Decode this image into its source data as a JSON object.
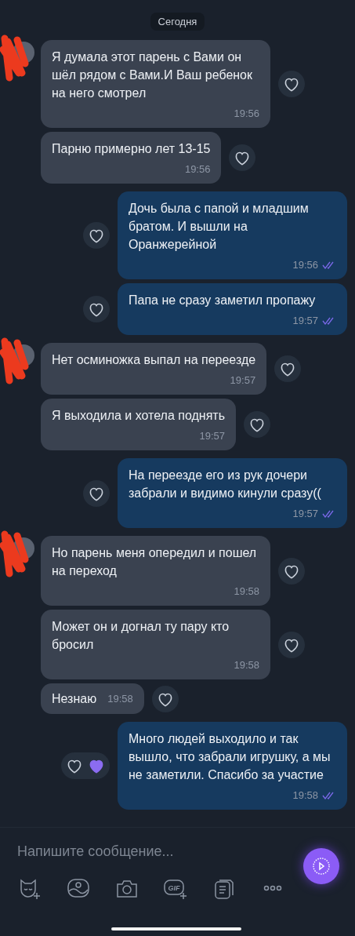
{
  "date_divider": "Сегодня",
  "groups": [
    {
      "kind": "incoming",
      "messages": [
        {
          "kind": "normal",
          "text": "Я думала этот парень с Вами он шёл рядом с Вами.И Ваш ребенок на него смотрел",
          "time": "19:56",
          "reacted": false
        },
        {
          "kind": "normal",
          "text": "Парню примерно лет 13-15",
          "time": "19:56",
          "reacted": false
        }
      ]
    },
    {
      "kind": "outgoing",
      "messages": [
        {
          "kind": "normal",
          "text": "Дочь была с папой и младшим братом. И вышли на Оранжерейной",
          "time": "19:56",
          "read": true,
          "reacted": false
        },
        {
          "kind": "normal",
          "text": "Папа не сразу заметил пропажу",
          "time": "19:57",
          "read": true,
          "reacted": false
        }
      ]
    },
    {
      "kind": "incoming",
      "messages": [
        {
          "kind": "normal",
          "text": "Нет осминожка выпал на переезде",
          "time": "19:57",
          "reacted": false
        },
        {
          "kind": "normal",
          "text": "Я выходила и хотела поднять",
          "time": "19:57",
          "reacted": false
        }
      ]
    },
    {
      "kind": "outgoing",
      "messages": [
        {
          "kind": "normal",
          "text": "На переезде его из рук дочери забрали и видимо кинули сразу((",
          "time": "19:57",
          "read": true,
          "reacted": false
        }
      ]
    },
    {
      "kind": "incoming",
      "messages": [
        {
          "kind": "normal",
          "text": "Но парень меня опередил и пошел на переход",
          "time": "19:58",
          "reacted": false
        },
        {
          "kind": "normal",
          "text": "Может он и догнал ту пару кто бросил",
          "time": "19:58",
          "reacted": false
        },
        {
          "kind": "short",
          "text": "Незнаю",
          "time": "19:58",
          "reacted": false
        }
      ]
    },
    {
      "kind": "outgoing",
      "messages": [
        {
          "kind": "normal",
          "text": "Много людей выходило и так вышло, что забрали игрушку, а мы не заметили. Спасибо за участие",
          "time": "19:58",
          "read": true,
          "reacted": true
        }
      ]
    }
  ],
  "composer": {
    "placeholder": "Напишите сообщение...",
    "tools": [
      {
        "kind": "sticker"
      },
      {
        "kind": "image"
      },
      {
        "kind": "camera"
      },
      {
        "kind": "gif",
        "label": "GIF"
      },
      {
        "kind": "document"
      },
      {
        "kind": "more"
      }
    ]
  }
}
